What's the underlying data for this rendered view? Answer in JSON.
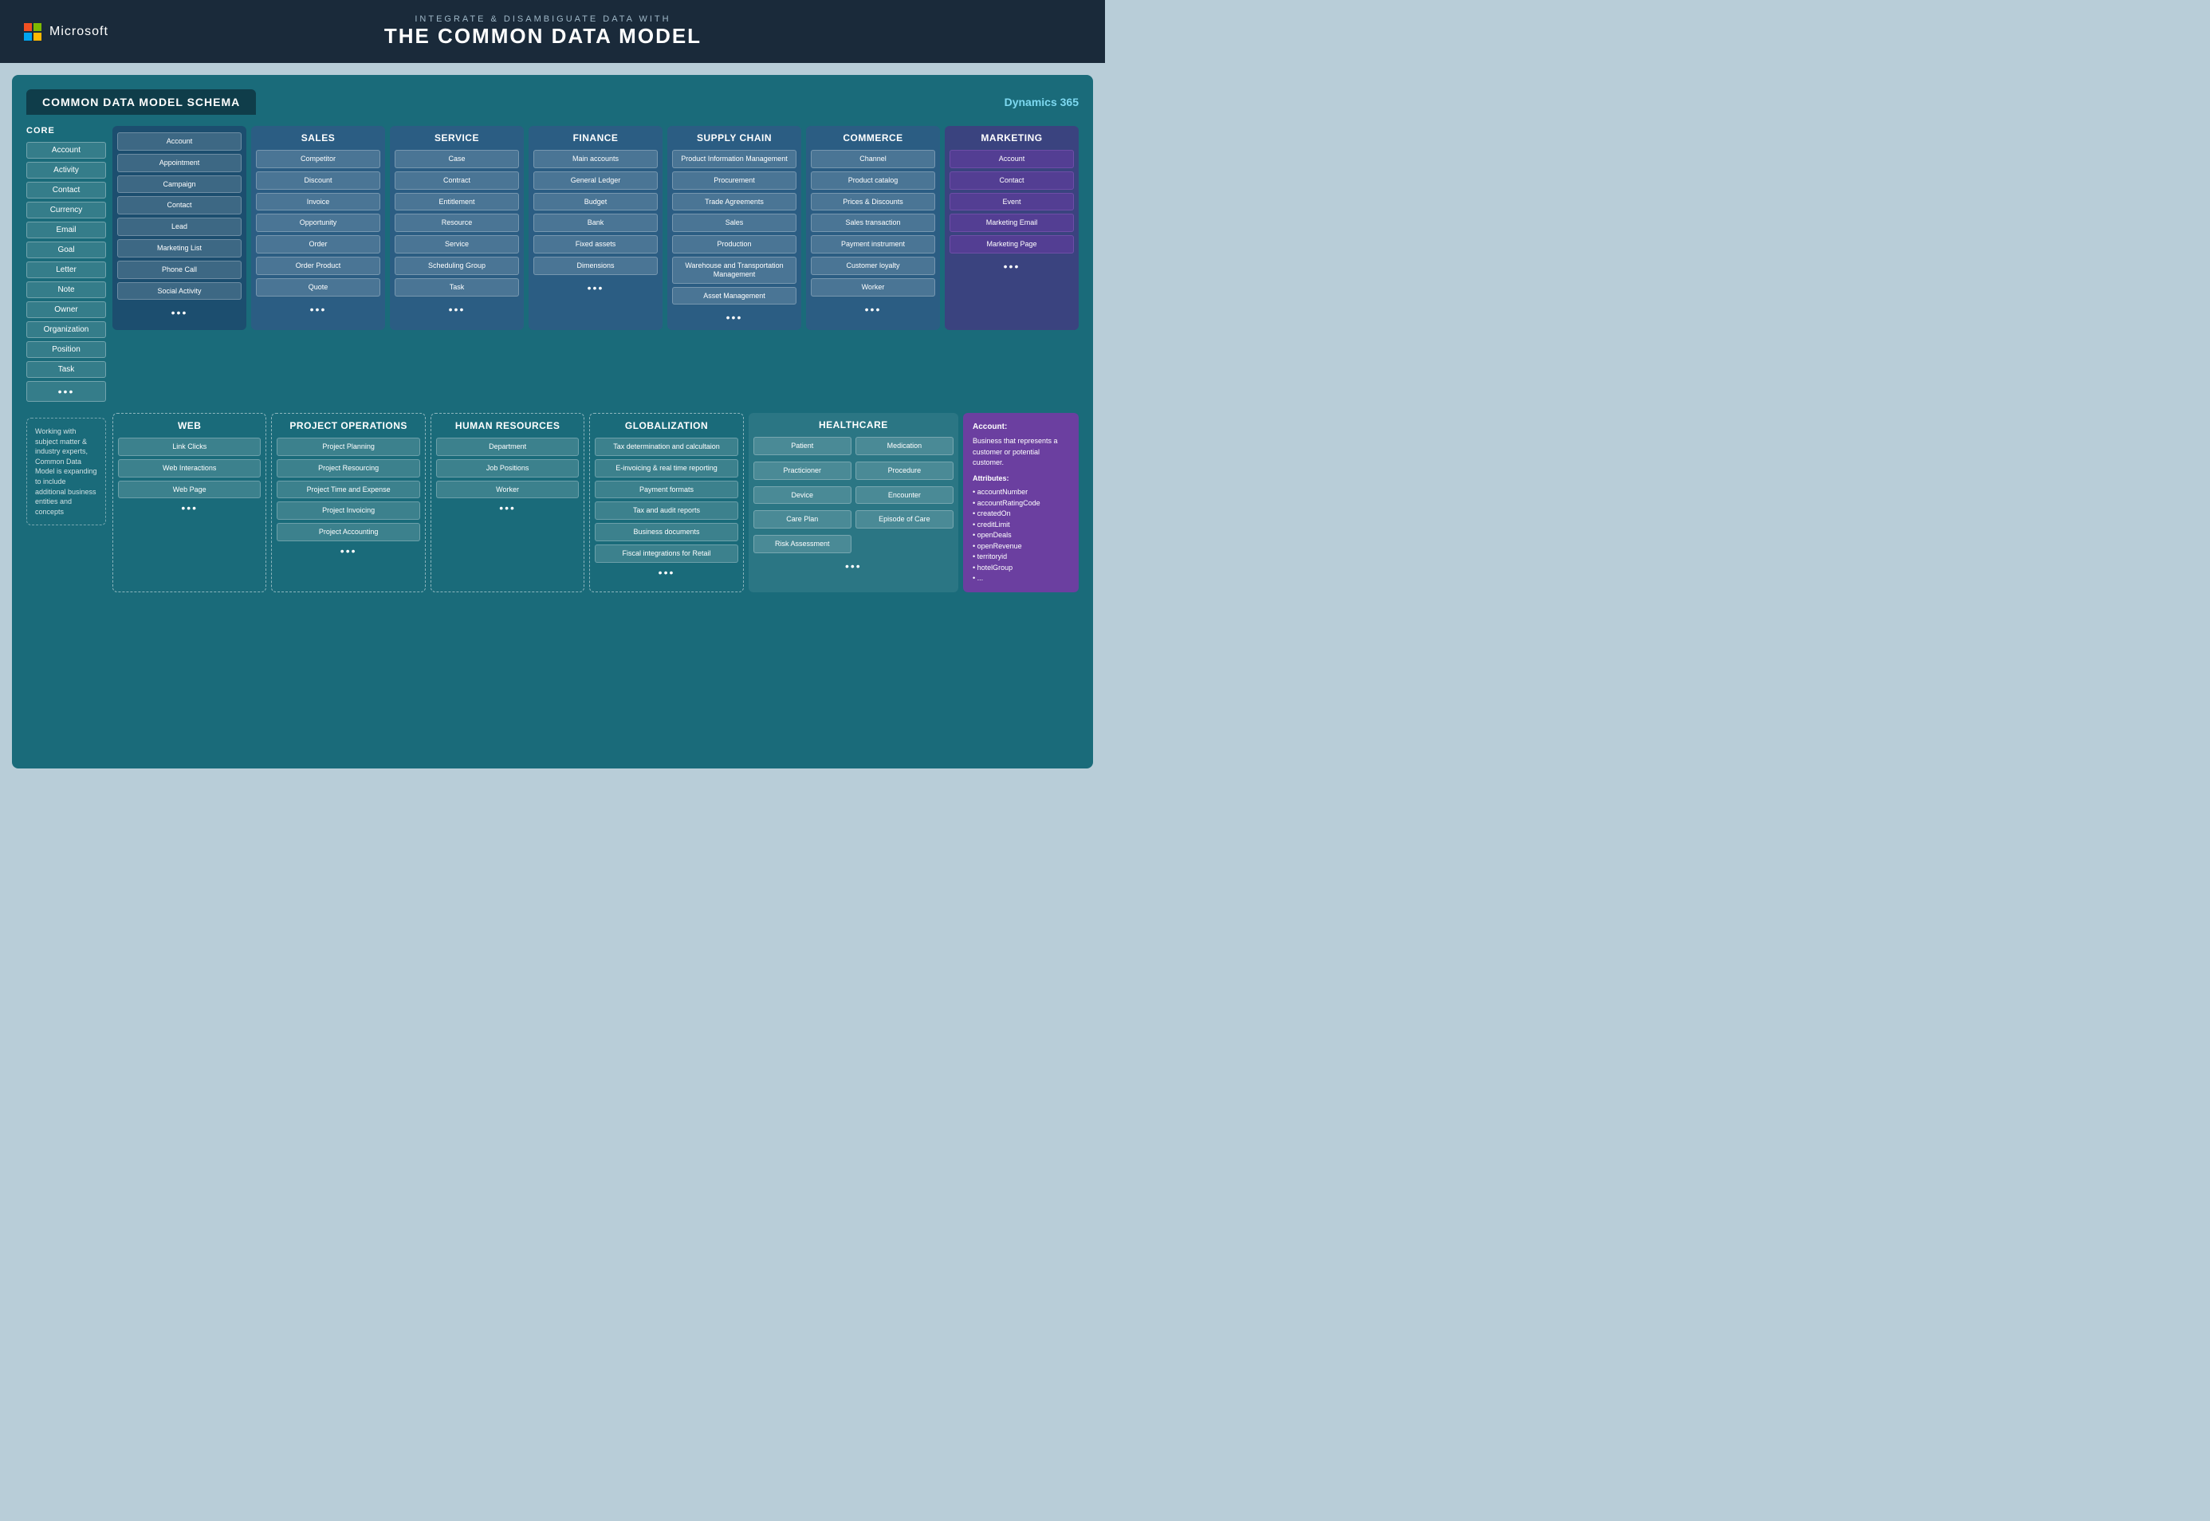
{
  "header": {
    "brand": "Microsoft",
    "subtitle": "INTEGRATE & DISAMBIGUATE DATA WITH",
    "main_title": "THE COMMON DATA MODEL"
  },
  "schema": {
    "title": "COMMON DATA MODEL SCHEMA",
    "dynamics_label": "Dynamics 365"
  },
  "core": {
    "label": "CORE",
    "items": [
      "Account",
      "Activity",
      "Contact",
      "Currency",
      "Email",
      "Goal",
      "Letter",
      "Note",
      "Owner",
      "Organization",
      "Position",
      "Task",
      "•••"
    ]
  },
  "common_col": {
    "items": [
      "Account",
      "Appointment",
      "Campaign",
      "Contact",
      "Lead",
      "Marketing List",
      "Phone Call",
      "Social Activity"
    ]
  },
  "modules": [
    {
      "name": "SALES",
      "items": [
        "Competitor",
        "Discount",
        "Invoice",
        "Opportunity",
        "Order",
        "Order Product",
        "Quote"
      ]
    },
    {
      "name": "SERVICE",
      "items": [
        "Case",
        "Contract",
        "Entitlement",
        "Resource",
        "Service",
        "Scheduling Group",
        "Task"
      ]
    },
    {
      "name": "FINANCE",
      "items": [
        "Main accounts",
        "General Ledger",
        "Budget",
        "Bank",
        "Fixed assets",
        "Dimensions"
      ]
    },
    {
      "name": "SUPPLY CHAIN",
      "items": [
        "Product Information Management",
        "Procurement",
        "Trade Agreements",
        "Sales",
        "Production",
        "Warehouse and Transportation Management",
        "Asset Management"
      ]
    },
    {
      "name": "COMMERCE",
      "items": [
        "Channel",
        "Product catalog",
        "Prices & Discounts",
        "Sales transaction",
        "Payment instrument",
        "Customer loyalty",
        "Worker"
      ]
    },
    {
      "name": "MARKETING",
      "items": [
        "Account",
        "Contact",
        "Event",
        "Marketing Email",
        "Marketing Page"
      ]
    }
  ],
  "bottom_modules": [
    {
      "name": "WEB",
      "items": [
        "Link Clicks",
        "Web Interactions",
        "Web Page"
      ]
    },
    {
      "name": "PROJECT OPERATIONS",
      "items": [
        "Project Planning",
        "Project Resourcing",
        "Project Time and Expense",
        "Project Invoicing",
        "Project Accounting"
      ]
    },
    {
      "name": "HUMAN RESOURCES",
      "items": [
        "Department",
        "Job Positions",
        "Worker"
      ]
    },
    {
      "name": "GLOBALIZATION",
      "items": [
        "Tax determination and calcultaion",
        "E-invoicing & real time reporting",
        "Payment formats",
        "Tax and audit reports",
        "Business documents",
        "Fiscal integrations for Retail"
      ]
    }
  ],
  "healthcare": {
    "name": "HEALTHCARE",
    "left_items": [
      "Patient",
      "Practicioner",
      "Device",
      "Care Plan",
      "Risk Assessment"
    ],
    "right_items": [
      "Medication",
      "Procedure",
      "Encounter",
      "Episode of Care"
    ],
    "dots": "•••"
  },
  "expanding_text": "Working with subject matter & industry experts, Common Data Model is expanding to include additional business entities and concepts",
  "account_info": {
    "title": "Account:",
    "description": "Business that represents a customer or potential customer.",
    "attributes_label": "Attributes:",
    "attributes": [
      "accountNumber",
      "accountRatingCode",
      "createdOn",
      "creditLimit",
      "openDeals",
      "openRevenue",
      "territoryid",
      "hotelGroup",
      "..."
    ]
  }
}
